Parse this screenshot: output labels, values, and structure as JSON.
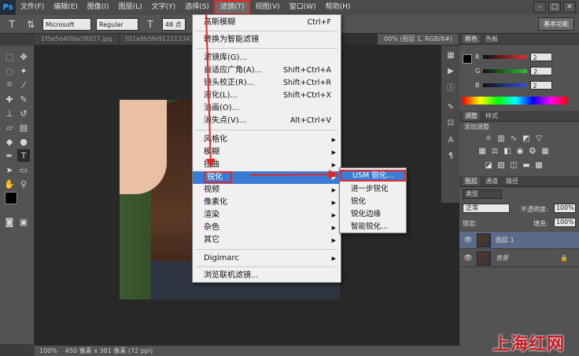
{
  "app": {
    "logo": "Ps"
  },
  "menubar": {
    "items": [
      "文件(F)",
      "编辑(E)",
      "图像(I)",
      "图层(L)",
      "文字(Y)",
      "选择(S)",
      "滤镜(T)",
      "视图(V)",
      "窗口(W)",
      "帮助(H)"
    ]
  },
  "window_controls": [
    "–",
    "□",
    "✕"
  ],
  "options": {
    "font_family": "Microsoft YaH...",
    "font_style": "Regular",
    "font_size": "48 点",
    "workspace": "基本功能"
  },
  "tabs": [
    "1f5e5e409ac0fd27.jpg",
    "t01a9b5fe9122133​47e.jpg",
    "00% (图层 1, RGB/8#)"
  ],
  "status": {
    "zoom": "100%",
    "info": "450 像素 x 381 像素 (72 ppi)"
  },
  "filter_menu": {
    "items": [
      {
        "label": "高斯模糊",
        "shortcut": "Ctrl+F"
      },
      {
        "label": "转换为智能滤镜",
        "shortcut": ""
      },
      {
        "label": "滤镜库(G)...",
        "shortcut": ""
      },
      {
        "label": "自适应广角(A)...",
        "shortcut": "Shift+Ctrl+A"
      },
      {
        "label": "镜头校正(R)...",
        "shortcut": "Shift+Ctrl+R"
      },
      {
        "label": "液化(L)...",
        "shortcut": "Shift+Ctrl+X"
      },
      {
        "label": "油画(O)...",
        "shortcut": ""
      },
      {
        "label": "消失点(V)...",
        "shortcut": "Alt+Ctrl+V"
      },
      {
        "label": "风格化",
        "shortcut": ""
      },
      {
        "label": "模糊",
        "shortcut": ""
      },
      {
        "label": "扭曲",
        "shortcut": ""
      },
      {
        "label": "锐化",
        "shortcut": ""
      },
      {
        "label": "视频",
        "shortcut": ""
      },
      {
        "label": "像素化",
        "shortcut": ""
      },
      {
        "label": "渲染",
        "shortcut": ""
      },
      {
        "label": "杂色",
        "shortcut": ""
      },
      {
        "label": "其它",
        "shortcut": ""
      },
      {
        "label": "Digimarc",
        "shortcut": ""
      },
      {
        "label": "浏览联机滤镜...",
        "shortcut": ""
      }
    ]
  },
  "sharpen_menu": {
    "items": [
      "USM 锐化...",
      "进一步锐化",
      "锐化",
      "锐化边缘",
      "智能锐化..."
    ]
  },
  "color_panel": {
    "tabs": [
      "颜色",
      "色板"
    ],
    "channels": [
      {
        "name": "R",
        "value": "2",
        "color": "#e03030"
      },
      {
        "name": "G",
        "value": "2",
        "color": "#30c030"
      },
      {
        "name": "B",
        "value": "2",
        "color": "#3050e0"
      }
    ]
  },
  "adjust_panel": {
    "tabs": [
      "调整",
      "样式"
    ],
    "title": "添加调整"
  },
  "layers_panel": {
    "tabs": [
      "图层",
      "通道",
      "路径"
    ],
    "kind": "类型",
    "blend": "正常",
    "opacity_label": "不透明度:",
    "opacity": "100%",
    "lock_label": "锁定:",
    "fill_label": "填充:",
    "fill": "100%",
    "layers": [
      {
        "name": "图层 1"
      },
      {
        "name": "背景"
      }
    ]
  },
  "watermark": "上海红网"
}
